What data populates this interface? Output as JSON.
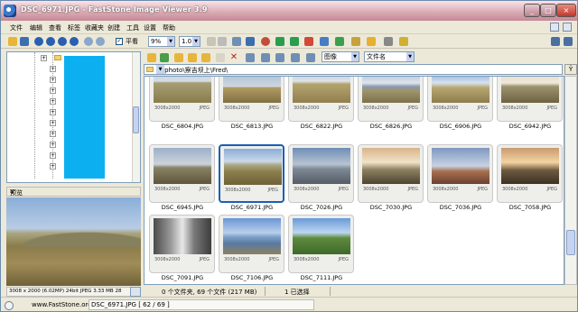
{
  "window": {
    "title": "DSC_6971.JPG - FastStone Image Viewer 3.9"
  },
  "menu": [
    "文件",
    "编辑",
    "查看",
    "标签",
    "收藏夹",
    "创建",
    "工具",
    "设置",
    "帮助"
  ],
  "toolbar": {
    "fullscreen_label": "平看",
    "zoom_value": "9%",
    "ratio_value": "1.0"
  },
  "right_toolbar": {
    "view_select": "图像",
    "sort_select": "文件名"
  },
  "path": {
    "value": "E:\\photo\\察吉坝上\\Fred\\"
  },
  "preview_panel": {
    "label": "预览",
    "status": "3008 x 2000 (6.02MP)   24bit JPEG   3.33 MB   28"
  },
  "thumbnails": [
    {
      "name": "DSC_6804.JPG",
      "dims": "3008x2000",
      "fmt": "JPEG",
      "scene": "A",
      "selected": false
    },
    {
      "name": "DSC_6813.JPG",
      "dims": "3008x2000",
      "fmt": "JPEG",
      "scene": "B",
      "selected": false
    },
    {
      "name": "DSC_6822.JPG",
      "dims": "3008x2000",
      "fmt": "JPEG",
      "scene": "C",
      "selected": false
    },
    {
      "name": "DSC_6826.JPG",
      "dims": "3008x2000",
      "fmt": "JPEG",
      "scene": "D",
      "selected": false
    },
    {
      "name": "DSC_6906.JPG",
      "dims": "3008x2000",
      "fmt": "JPEG",
      "scene": "E",
      "selected": false
    },
    {
      "name": "DSC_6942.JPG",
      "dims": "3008x2000",
      "fmt": "JPEG",
      "scene": "F",
      "selected": false
    },
    {
      "name": "DSC_6945.JPG",
      "dims": "3008x2000",
      "fmt": "JPEG",
      "scene": "G",
      "selected": false
    },
    {
      "name": "DSC_6971.JPG",
      "dims": "3008x2000",
      "fmt": "JPEG",
      "scene": "H",
      "selected": true
    },
    {
      "name": "DSC_7026.JPG",
      "dims": "3008x2000",
      "fmt": "JPEG",
      "scene": "I",
      "selected": false
    },
    {
      "name": "DSC_7030.JPG",
      "dims": "3008x2000",
      "fmt": "JPEG",
      "scene": "J",
      "selected": false
    },
    {
      "name": "DSC_7036.JPG",
      "dims": "3008x2000",
      "fmt": "JPEG",
      "scene": "K",
      "selected": false
    },
    {
      "name": "DSC_7058.JPG",
      "dims": "3008x2000",
      "fmt": "JPEG",
      "scene": "L",
      "selected": false
    },
    {
      "name": "DSC_7091.JPG",
      "dims": "3008x2000",
      "fmt": "JPEG",
      "scene": "M",
      "selected": false
    },
    {
      "name": "DSC_7106.JPG",
      "dims": "3008x2000",
      "fmt": "JPEG",
      "scene": "N",
      "selected": false
    },
    {
      "name": "DSC_7111.JPG",
      "dims": "3008x2000",
      "fmt": "JPEG",
      "scene": "O",
      "selected": false
    }
  ],
  "status": {
    "folder_count": "0 个文件夹, 69 个文件 (217 MB)",
    "selected": "1 已选择"
  },
  "bottom": {
    "url": "www.FastStone.org",
    "file_info": "DSC_6971.JPG [ 62 / 69 ]"
  },
  "colors": {
    "selection": "#1a5fb4",
    "tree_highlight": "#0cb0f0"
  }
}
